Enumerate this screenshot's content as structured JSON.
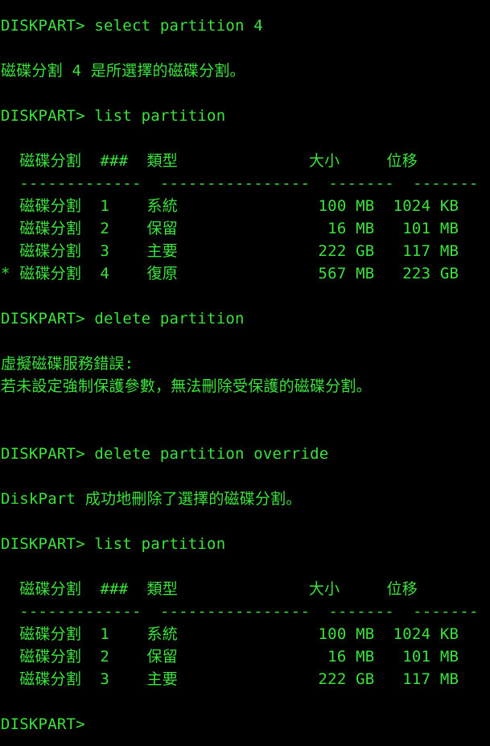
{
  "terminal": {
    "text_color": "#3ee23e",
    "background": "#000000",
    "lines": [
      "DISKPART> select partition 4",
      "",
      "磁碟分割 4 是所選擇的磁碟分割。",
      "",
      "DISKPART> list partition",
      "",
      "  磁碟分割  ###  類型              大小     位移",
      "  -------------  ----------------  -------  -------",
      "  磁碟分割  1    系統               100 MB  1024 KB",
      "  磁碟分割  2    保留                16 MB   101 MB",
      "  磁碟分割  3    主要               222 GB   117 MB",
      "* 磁碟分割  4    復原               567 MB   223 GB",
      "",
      "DISKPART> delete partition",
      "",
      "虛擬磁碟服務錯誤:",
      "若未設定強制保護參數，無法刪除受保護的磁碟分割。",
      "",
      "",
      "DISKPART> delete partition override",
      "",
      "DiskPart 成功地刪除了選擇的磁碟分割。",
      "",
      "DISKPART> list partition",
      "",
      "  磁碟分割  ###  類型              大小     位移",
      "  -------------  ----------------  -------  -------",
      "  磁碟分割  1    系統               100 MB  1024 KB",
      "  磁碟分割  2    保留                16 MB   101 MB",
      "  磁碟分割  3    主要               222 GB   117 MB",
      "",
      "DISKPART> "
    ]
  }
}
